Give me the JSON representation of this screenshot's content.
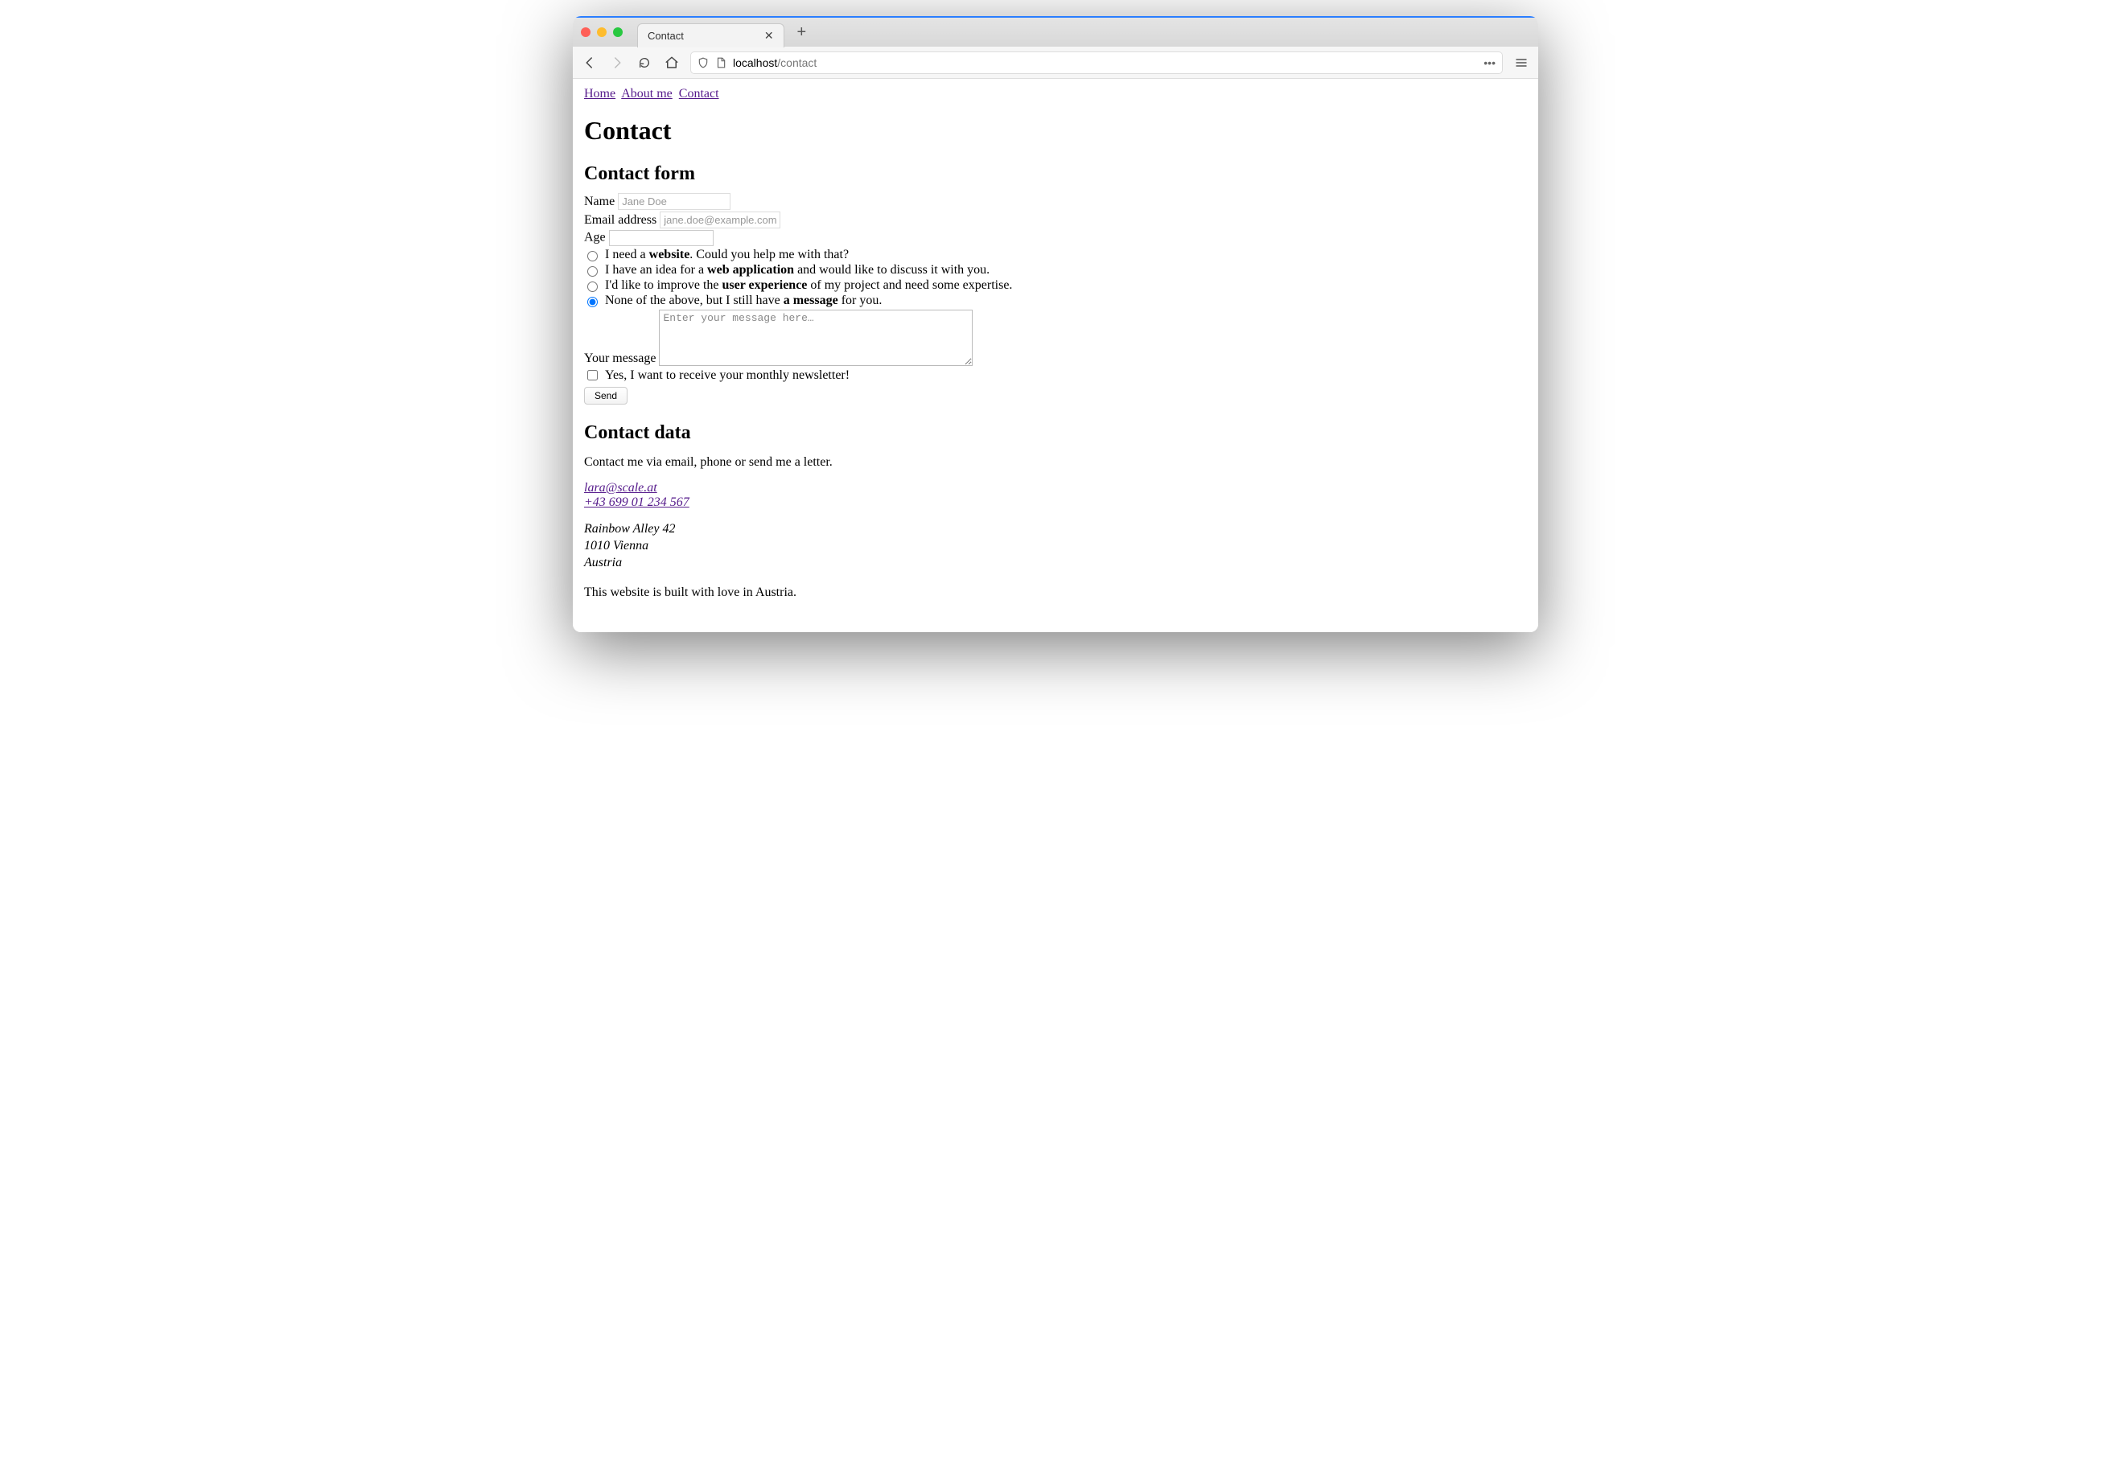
{
  "browser": {
    "tab_title": "Contact",
    "url_host": "localhost",
    "url_path": "/contact"
  },
  "nav": {
    "home": "Home",
    "about": "About me",
    "contact": "Contact"
  },
  "page": {
    "title": "Contact",
    "form_heading": "Contact form",
    "name_label": "Name",
    "name_placeholder": "Jane Doe",
    "email_label": "Email address",
    "email_placeholder": "jane.doe@example.com",
    "age_label": "Age",
    "radio1_pre": "I need a ",
    "radio1_bold": "website",
    "radio1_post": ". Could you help me with that?",
    "radio2_pre": "I have an idea for a ",
    "radio2_bold": "web application",
    "radio2_post": " and would like to discuss it with you.",
    "radio3_pre": "I'd like to improve the ",
    "radio3_bold": "user experience",
    "radio3_post": " of my project and need some expertise.",
    "radio4_pre": "None of the above, but I still have ",
    "radio4_bold": "a message",
    "radio4_post": " for you.",
    "message_label": "Your message",
    "message_placeholder": "Enter your message here…",
    "newsletter_label": "Yes, I want to receive your monthly newsletter!",
    "send_label": "Send",
    "data_heading": "Contact data",
    "data_intro": "Contact me via email, phone or send me a letter.",
    "email_link": "lara@scale.at",
    "phone_link": "+43 699 01 234 567",
    "address_line1": "Rainbow Alley 42",
    "address_line2": "1010 Vienna",
    "address_line3": "Austria",
    "footer": "This website is built with love in Austria."
  }
}
